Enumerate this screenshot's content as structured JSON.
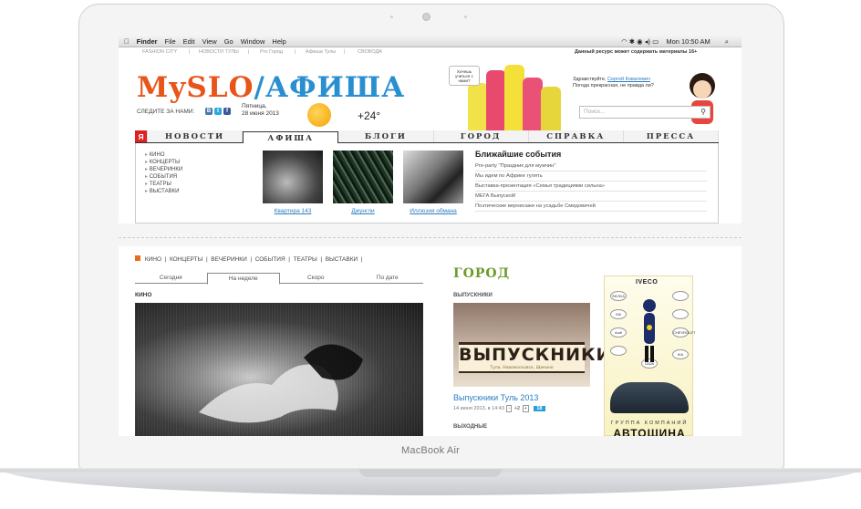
{
  "device": {
    "brand_label": "MacBook Air"
  },
  "menubar": {
    "apple": "",
    "items": [
      "Finder",
      "File",
      "Edit",
      "View",
      "Go",
      "Window",
      "Help"
    ],
    "clock": "Mon 10:50 AM"
  },
  "top_strip": {
    "links": [
      "FASHION CITY",
      "НОВОСТИ ТУЛЫ",
      "Pro Город",
      "Афиша Тулы",
      "СВОБОДА"
    ],
    "separator": "|",
    "disclaimer": "Данный ресурс может содержать материалы 16+"
  },
  "header": {
    "logo_part1": "MySLO",
    "logo_part2": "/АФИША",
    "follow_label": "СЛЕДИТЕ ЗА НАМИ:",
    "social": [
      "В",
      "t",
      "f"
    ],
    "day": "Пятница,",
    "date": "28 июня 2013",
    "temperature": "+24°",
    "bubble": "Хочешь учиться с нами?",
    "greeting_hello": "Здравствуйте,",
    "greeting_name": "Сергей Ковалевич",
    "greeting_text": "Погода прекрасная, не правда ли?",
    "search_placeholder": "Поиск...",
    "search_icon": "🔍"
  },
  "nav": {
    "ya": "Я",
    "items": [
      "НОВОСТИ",
      "АФИША",
      "БЛОГИ",
      "ГОРОД",
      "СПРАВКА",
      "ПРЕССА"
    ],
    "active": "АФИША"
  },
  "dropdown": {
    "categories": [
      "КИНО",
      "КОНЦЕРТЫ",
      "ВЕЧЕРИНКИ",
      "СОБЫТИЯ",
      "ТЕАТРЫ",
      "ВЫСТАВКИ"
    ],
    "films": [
      "Квартира 143",
      "Джунгли",
      "Иллюзия обмана"
    ],
    "events_title": "Ближайшие события",
    "events": [
      "Pre-party \"Праздник для мужчин\"",
      "Мы идем по Африке гулять",
      "Выставка-презентация «Семья традициями сильна»",
      "МЕГА Выпуской!",
      "Поэтические вернисажи на усадьбе Смидовичей"
    ]
  },
  "content": {
    "categories": [
      "КИНО",
      "КОНЦЕРТЫ",
      "ВЕЧЕРИНКИ",
      "СОБЫТИЯ",
      "ТЕАТРЫ",
      "ВЫСТАВКИ"
    ],
    "tabs": [
      "Сегодня",
      "На неделе",
      "Скоро",
      "По дате"
    ],
    "active_tab": "На неделе",
    "section_label": "КИНО"
  },
  "city": {
    "heading": "ГОРОД",
    "subsection": "ВЫПУСКНИКИ",
    "banner_text": "ВЫПУСКНИКИ",
    "banner_sub": "Тула, Новомосковск, Щекино",
    "article_title": "Выпускники Туль 2013",
    "article_meta": "14 июня 2013, в 14:43",
    "minus_label": "-",
    "votes": "+2",
    "plus_label": "+",
    "comments": "18",
    "next_subsection": "ВЫХОДНЫЕ"
  },
  "ad": {
    "top_brand": "IVECO",
    "brands": [
      "SKODA",
      "VW",
      "",
      "Audi",
      "",
      "",
      "CHEVROLET",
      "LADA",
      "KIA"
    ],
    "group_label": "ГРУППА КОМПАНИЙ",
    "company": "АВТОШИНА"
  },
  "colors": {
    "accent_orange": "#e66b1a",
    "nav_red": "#dd2222",
    "link_blue": "#2a7ec3",
    "city_green": "#6b9b29"
  }
}
